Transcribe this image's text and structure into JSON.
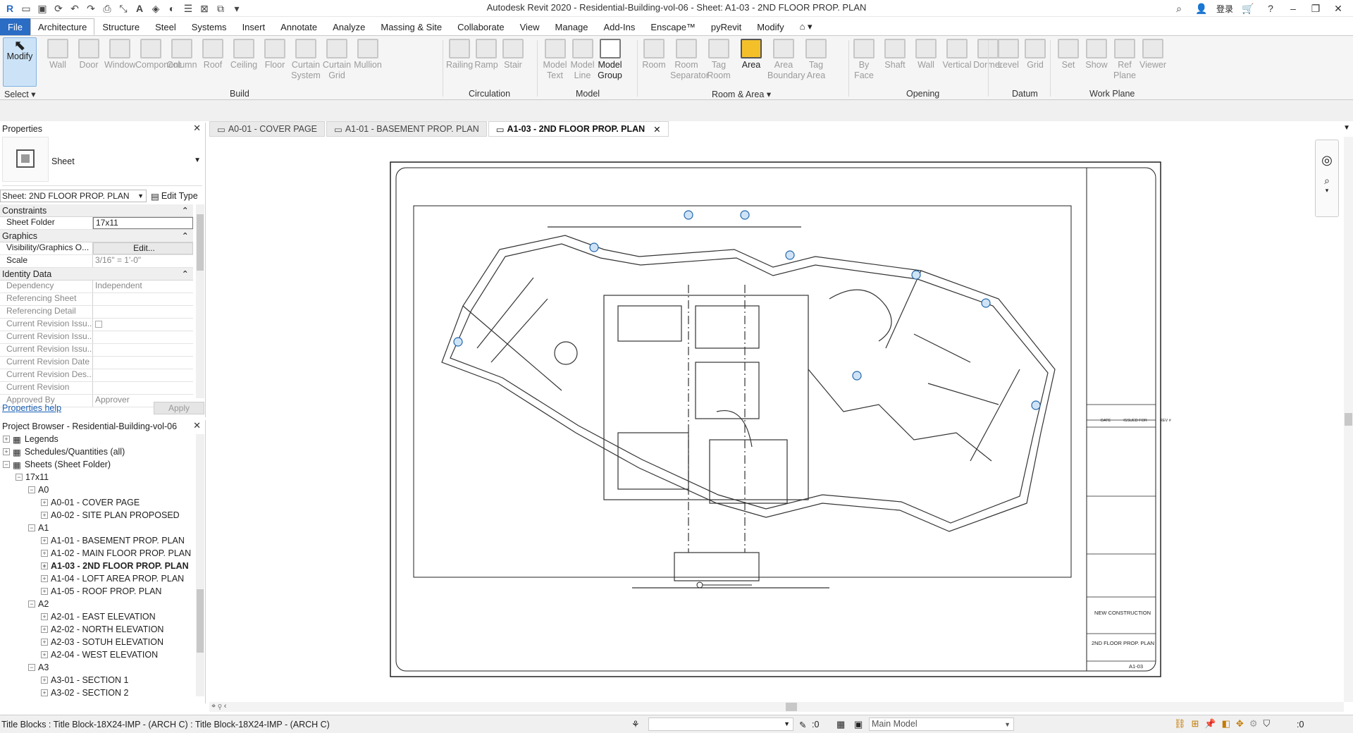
{
  "app": {
    "title": "Autodesk Revit 2020 - Residential-Building-vol-06 - Sheet: A1-03 - 2ND FLOOR PROP. PLAN",
    "user": "登录",
    "logo": "R"
  },
  "menu": [
    "File",
    "Architecture",
    "Structure",
    "Steel",
    "Systems",
    "Insert",
    "Annotate",
    "Analyze",
    "Massing & Site",
    "Collaborate",
    "View",
    "Manage",
    "Add-Ins",
    "Enscape™",
    "pyRevit",
    "Modify"
  ],
  "ribbon": {
    "modify": "Modify",
    "select": "Select ▾",
    "build": [
      [
        "Wall"
      ],
      [
        "Door"
      ],
      [
        "Window"
      ],
      [
        "Component"
      ],
      [
        "Column"
      ],
      [
        "Roof"
      ],
      [
        "Ceiling"
      ],
      [
        "Floor"
      ],
      [
        "Curtain",
        "System"
      ],
      [
        "Curtain",
        "Grid"
      ],
      [
        "Mullion"
      ]
    ],
    "circulation": [
      [
        "Railing"
      ],
      [
        "Ramp"
      ],
      [
        "Stair"
      ]
    ],
    "model": [
      [
        "Model",
        "Text"
      ],
      [
        "Model",
        "Line"
      ],
      [
        "Model",
        "Group"
      ]
    ],
    "roomarea": [
      [
        "Room"
      ],
      [
        "Room",
        "Separator"
      ],
      [
        "Tag",
        "Room"
      ],
      [
        "Area"
      ],
      [
        "Area",
        "Boundary"
      ],
      [
        "Tag",
        "Area"
      ]
    ],
    "opening": [
      [
        "By",
        "Face"
      ],
      [
        "Shaft"
      ],
      [
        "Wall"
      ],
      [
        "Vertical"
      ],
      [
        "Dormer"
      ]
    ],
    "datum": [
      [
        "Level"
      ],
      [
        "Grid"
      ]
    ],
    "workplane": [
      [
        "Set"
      ],
      [
        "Show"
      ],
      [
        "Ref",
        "Plane"
      ],
      [
        "Viewer"
      ]
    ],
    "panels": {
      "build": "Build",
      "circulation": "Circulation",
      "model": "Model",
      "roomarea": "Room & Area ▾",
      "opening": "Opening",
      "datum": "Datum",
      "workplane": "Work Plane"
    }
  },
  "properties": {
    "title": "Properties",
    "type": "Sheet",
    "instance": "Sheet: 2ND FLOOR PROP. PLAN",
    "edit_type": "Edit Type",
    "sections": [
      {
        "name": "Constraints",
        "rows": [
          [
            "Sheet Folder",
            "17x11"
          ]
        ]
      },
      {
        "name": "Graphics",
        "rows": [
          [
            "Visibility/Graphics O...",
            "Edit..."
          ],
          [
            "Scale",
            "3/16\" = 1'-0\""
          ]
        ]
      },
      {
        "name": "Identity Data",
        "rows": [
          [
            "Dependency",
            "Independent"
          ],
          [
            "Referencing Sheet",
            ""
          ],
          [
            "Referencing Detail",
            ""
          ],
          [
            "Current Revision Issu...",
            ""
          ],
          [
            "Current Revision Issu...",
            ""
          ],
          [
            "Current Revision Issu...",
            ""
          ],
          [
            "Current Revision Date",
            ""
          ],
          [
            "Current Revision Des...",
            ""
          ],
          [
            "Current Revision",
            ""
          ],
          [
            "Approved By",
            "Approver"
          ]
        ]
      }
    ],
    "help": "Properties help",
    "apply": "Apply"
  },
  "browser": {
    "title": "Project Browser - Residential-Building-vol-06",
    "items": [
      {
        "t": "Legends",
        "l": 0,
        "tog": "+"
      },
      {
        "t": "Schedules/Quantities (all)",
        "l": 0,
        "tog": "+"
      },
      {
        "t": "Sheets (Sheet Folder)",
        "l": 0,
        "tog": "−"
      },
      {
        "t": "17x11",
        "l": 1,
        "tog": "−"
      },
      {
        "t": "A0",
        "l": 2,
        "tog": "−"
      },
      {
        "t": "A0-01 - COVER PAGE",
        "l": 3,
        "tog": "+"
      },
      {
        "t": "A0-02 - SITE PLAN PROPOSED",
        "l": 3,
        "tog": "+"
      },
      {
        "t": "A1",
        "l": 2,
        "tog": "−"
      },
      {
        "t": "A1-01 - BASEMENT PROP. PLAN",
        "l": 3,
        "tog": "+"
      },
      {
        "t": "A1-02 - MAIN FLOOR PROP. PLAN",
        "l": 3,
        "tog": "+"
      },
      {
        "t": "A1-03 - 2ND FLOOR PROP. PLAN",
        "l": 3,
        "tog": "+",
        "b": true
      },
      {
        "t": "A1-04 - LOFT AREA PROP. PLAN",
        "l": 3,
        "tog": "+"
      },
      {
        "t": "A1-05 - ROOF PROP. PLAN",
        "l": 3,
        "tog": "+"
      },
      {
        "t": "A2",
        "l": 2,
        "tog": "−"
      },
      {
        "t": "A2-01 - EAST ELEVATION",
        "l": 3,
        "tog": "+"
      },
      {
        "t": "A2-02 - NORTH ELEVATION",
        "l": 3,
        "tog": "+"
      },
      {
        "t": "A2-03 - SOTUH ELEVATION",
        "l": 3,
        "tog": "+"
      },
      {
        "t": "A2-04 - WEST ELEVATION",
        "l": 3,
        "tog": "+"
      },
      {
        "t": "A3",
        "l": 2,
        "tog": "−"
      },
      {
        "t": "A3-01 - SECTION 1",
        "l": 3,
        "tog": "+"
      },
      {
        "t": "A3-02 - SECTION 2",
        "l": 3,
        "tog": "+"
      }
    ]
  },
  "tabs": [
    {
      "label": "A0-01 - COVER PAGE"
    },
    {
      "label": "A1-01 - BASEMENT PROP. PLAN"
    },
    {
      "label": "A1-03 - 2ND FLOOR PROP. PLAN",
      "active": true
    }
  ],
  "titleblock": {
    "project_name": "NEW CONSTRUCTION",
    "sheet_name": "2ND FLOOR PROP. PLAN",
    "sheet_no": "A1-03",
    "date_col": "DATE",
    "issued_col": "ISSUED FOR",
    "rev_col": "REV #"
  },
  "status": {
    "left": "Title Blocks : Title Block-18X24-IMP - (ARCH C) : Title Block-18X24-IMP - (ARCH C)",
    "model": "Main Model",
    "zero": ":0",
    "filter": ":0"
  }
}
